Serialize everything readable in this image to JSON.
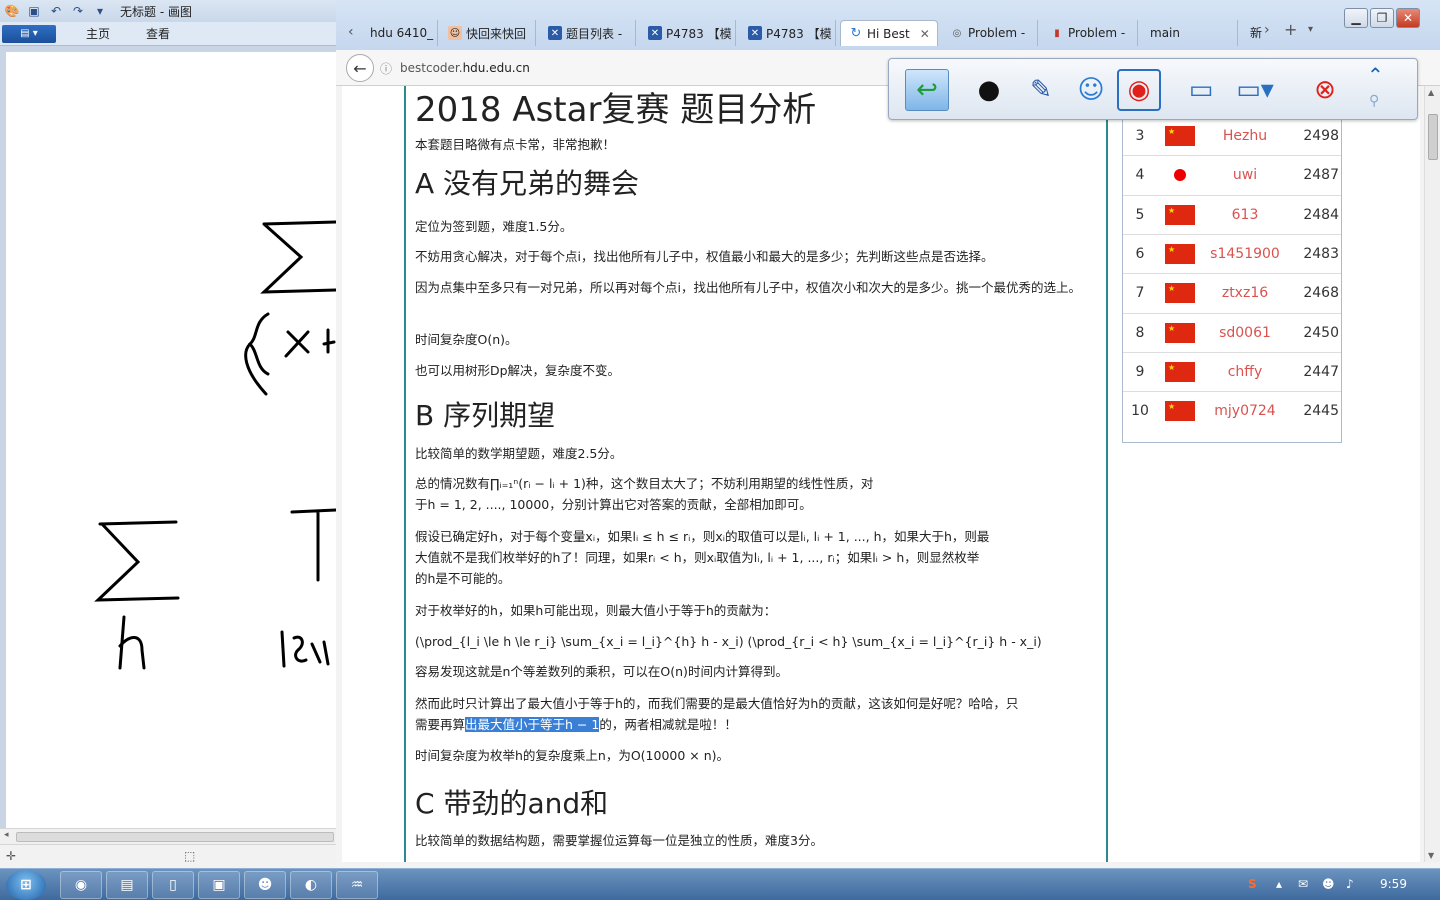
{
  "paint": {
    "title": "无标题 - 画图",
    "tabs": [
      "主页",
      "查看"
    ],
    "file_menu_icon": "menu-icon"
  },
  "browser": {
    "tabs": [
      {
        "label": "hdu 6410_",
        "icon": "page-icon"
      },
      {
        "label": "快回来快回",
        "icon": "avatar-icon"
      },
      {
        "label": "题目列表 -",
        "icon": "bestcoder-icon"
      },
      {
        "label": "P4783 【模",
        "icon": "bestcoder-icon"
      },
      {
        "label": "P4783 【模",
        "icon": "bestcoder-icon"
      },
      {
        "label": "Hi Best",
        "icon": "refresh-icon",
        "active": true
      },
      {
        "label": "Problem -",
        "icon": "problem-icon"
      },
      {
        "label": "Problem -",
        "icon": "chart-icon"
      },
      {
        "label": "main",
        "icon": ""
      }
    ],
    "url_prefix": "bestcoder.",
    "url_domain": "hdu.edu.cn",
    "url_suffix": ""
  },
  "article": {
    "title": "2018 Astar复赛 题目分析",
    "intro": "本套题目略微有点卡常，非常抱歉！",
    "section_a": {
      "heading": "A 没有兄弟的舞会",
      "p1": "定位为签到题，难度1.5分。",
      "p2": "不妨用贪心解决，对于每个点i，找出他所有儿子中，权值最小和最大的是多少；先判断这些点是否选择。",
      "p3": "因为点集中至多只有一对兄弟，所以再对每个点i，找出他所有儿子中，权值次小和次大的是多少。挑一个最优秀的选上。",
      "p4": "时间复杂度O(n)。",
      "p5": "也可以用树形Dp解决，复杂度不变。"
    },
    "section_b": {
      "heading": "B 序列期望",
      "p1": "比较简单的数学期望题，难度2.5分。",
      "p2a": "总的情况数有∏ᵢ₌₁ⁿ(rᵢ − lᵢ + 1)种，这个数目太大了；不妨利用期望的线性性质，对",
      "p2b": "于h = 1, 2, ...., 10000，分别计算出它对答案的贡献，全部相加即可。",
      "p3a": "假设已确定好h，对于每个变量xᵢ，如果lᵢ ≤ h ≤ rᵢ，则xᵢ的取值可以是lᵢ, lᵢ + 1, ..., h，如果大于h，则最",
      "p3b": "大值就不是我们枚举好的h了！同理，如果rᵢ < h，则xᵢ取值为lᵢ, lᵢ + 1, ..., rᵢ；如果lᵢ > h，则显然枚举",
      "p3c": "的h是不可能的。",
      "p4": "对于枚举好的h，如果h可能出现，则最大值小于等于h的贡献为：",
      "p5": "(\\prod_{l_i \\le h \\le r_i} \\sum_{x_i = l_i}^{h} h - x_i) (\\prod_{r_i < h} \\sum_{x_i = l_i}^{r_i} h - x_i)",
      "p6": "容易发现这就是n个等差数列的乘积，可以在O(n)时间内计算得到。",
      "p7a": "然而此时只计算出了最大值小于等于h的，而我们需要的是最大值恰好为h的贡献，这该如何是好呢？哈哈，只",
      "p7b_pre": "需要再算",
      "p7b_hl": "出最大值小于等于h − 1",
      "p7b_post": "的，两者相减就是啦！！",
      "p8": "时间复杂度为枚举h的复杂度乘上n，为O(10000 × n)。"
    },
    "section_c": {
      "heading": "C 带劲的and和",
      "p1": "比较简单的数据结构题，需要掌握位运算每一位是独立的性质，难度3分。"
    }
  },
  "ranking": [
    {
      "rank": "3",
      "flag": "china-flag",
      "name": "Hezhu",
      "score": "2498"
    },
    {
      "rank": "4",
      "flag": "japan-flag",
      "name": "uwi",
      "score": "2487"
    },
    {
      "rank": "5",
      "flag": "china-flag",
      "name": "613",
      "score": "2484"
    },
    {
      "rank": "6",
      "flag": "china-flag",
      "name": "s1451900",
      "score": "2483"
    },
    {
      "rank": "7",
      "flag": "china-flag",
      "name": "ztxz16",
      "score": "2468"
    },
    {
      "rank": "8",
      "flag": "china-flag",
      "name": "sd0061",
      "score": "2450"
    },
    {
      "rank": "9",
      "flag": "china-flag",
      "name": "chffy",
      "score": "2447"
    },
    {
      "rank": "10",
      "flag": "china-flag",
      "name": "mjy0724",
      "score": "2445"
    }
  ],
  "taskbar": {
    "clock": "9:59"
  },
  "colors": {
    "accent_teal": "#2a8a8e",
    "selection": "#3a7fd6",
    "rank_name": "#d9534f"
  }
}
